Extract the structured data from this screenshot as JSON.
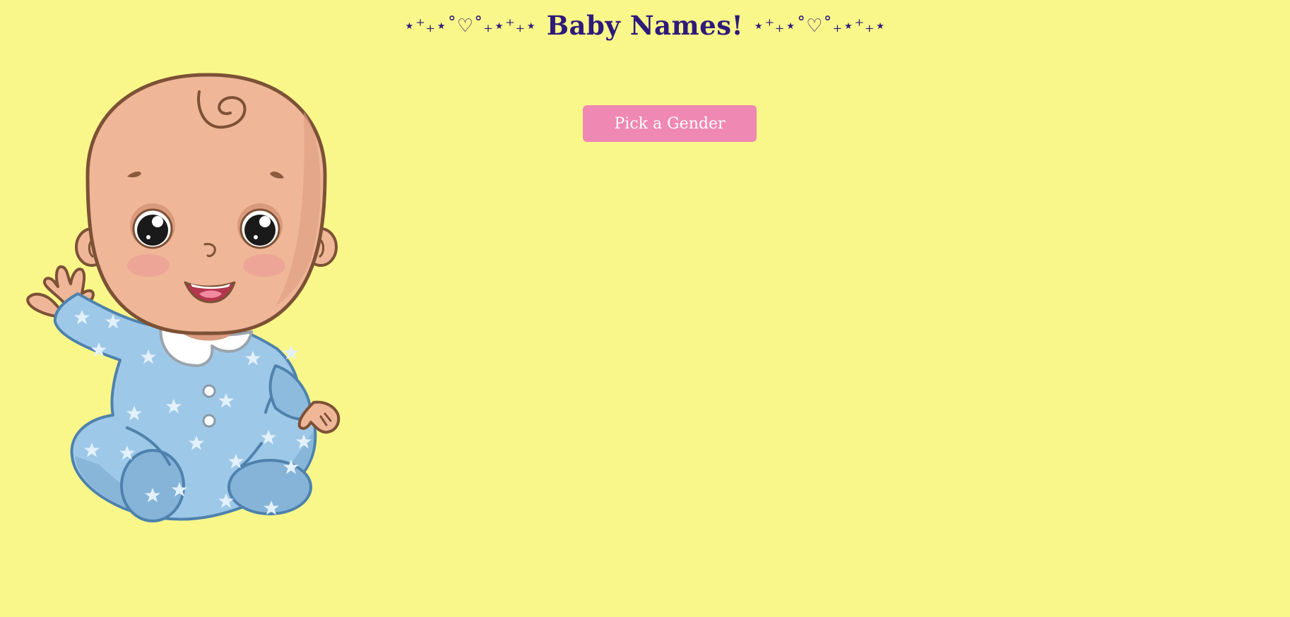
{
  "header": {
    "title": "Baby Names!",
    "decoration_left": "⋆⁺₊⋆˚♡˚₊⋆⁺₊⋆",
    "decoration_right": "⋆⁺₊⋆˚♡˚₊⋆⁺₊⋆"
  },
  "main": {
    "pick_gender_label": "Pick a Gender"
  },
  "colors": {
    "background": "#f9f78a",
    "title": "#2e1a7a",
    "button": "#ef88b2",
    "onesie": "#9ec8e8"
  },
  "illustration": {
    "icon": "baby-icon"
  }
}
